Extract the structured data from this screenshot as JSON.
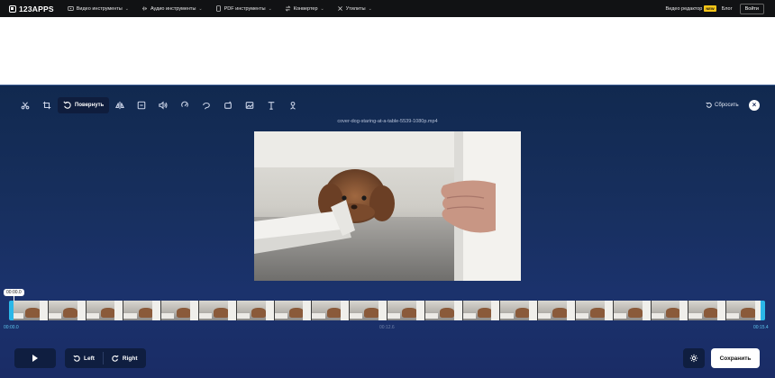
{
  "nav": {
    "logo": "123APPS",
    "items": [
      {
        "label": "Видео инструменты",
        "icon": "video-icon"
      },
      {
        "label": "Аудио инструменты",
        "icon": "audio-icon"
      },
      {
        "label": "PDF инструменты",
        "icon": "pdf-icon"
      },
      {
        "label": "Конвертер",
        "icon": "convert-icon"
      },
      {
        "label": "Утилиты",
        "icon": "tools-icon"
      }
    ],
    "video_editor": "Видео редактор",
    "new_badge": "NEW",
    "blog": "Блог",
    "login": "Войти"
  },
  "toolbar": {
    "tools": [
      "cut-icon",
      "crop-icon",
      "rotate-icon",
      "flip-icon",
      "resize-icon",
      "volume-icon",
      "speed-icon",
      "loop-icon",
      "stabilize-icon",
      "image-icon",
      "text-icon",
      "record-icon"
    ],
    "active_label": "Повернуть",
    "reset_label": "Сбросить"
  },
  "video": {
    "filename": "cover-dog-staring-at-a-table-5539-1080p.mp4"
  },
  "timeline": {
    "current_time": "00:00.0",
    "start_time": "00:00.0",
    "mid_time": "00:12.6",
    "end_time": "00:15.4",
    "frame_count": 20
  },
  "controls": {
    "left_label": "Left",
    "right_label": "Right",
    "save_label": "Сохранить"
  }
}
